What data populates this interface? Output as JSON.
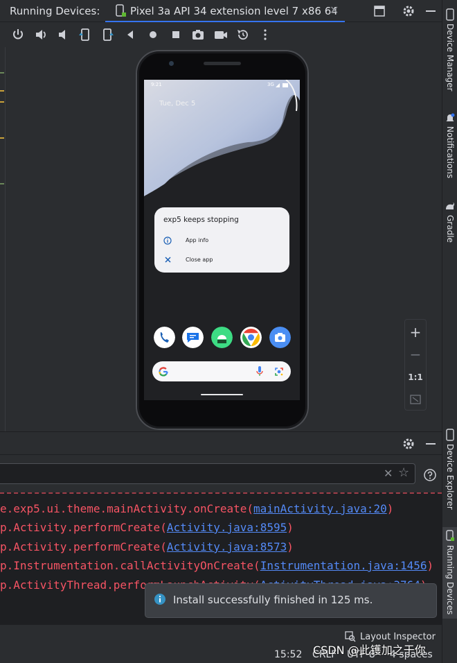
{
  "top_bar": {
    "title": "Running Devices:",
    "device_tab": "Pixel 3a API 34 extension level 7 x86 64",
    "close_glyph": "✕"
  },
  "device_toolbar": {
    "icons": [
      "power-icon",
      "volume-up-icon",
      "volume-down-icon",
      "rotate-left-icon",
      "rotate-right-icon",
      "back-icon",
      "home-icon",
      "overview-icon",
      "screenshot-icon",
      "screen-record-icon",
      "snapshot-icon",
      "more-icon"
    ]
  },
  "phone": {
    "status_time": "9:21",
    "status_network": "3G",
    "date": "Tue, Dec 5",
    "dialog": {
      "title": "exp5 keeps stopping",
      "app_info": "App info",
      "close_app": "Close app"
    },
    "dock_apps": [
      "phone",
      "messages",
      "android",
      "chrome",
      "camera"
    ]
  },
  "zoom": {
    "plus": "+",
    "minus": "−",
    "one_to_one": "1:1"
  },
  "right_bar": {
    "device_manager": "Device Manager",
    "notifications": "Notifications",
    "gradle": "Gradle",
    "device_explorer": "Device Explorer",
    "running_devices": "Running Devices"
  },
  "log": {
    "lines": [
      {
        "text": "e.exp5.ui.theme.mainActivity.onCreate(",
        "link": "mainActivity.java:20",
        "end": ")"
      },
      {
        "text": "p.Activity.performCreate(",
        "link": "Activity.java:8595",
        "end": ")"
      },
      {
        "text": "p.Activity.performCreate(",
        "link": "Activity.java:8573",
        "end": ")"
      },
      {
        "text": "p.Instrumentation.callActivityOnCreate(",
        "link": "Instrumentation.java:1456",
        "end": ")"
      },
      {
        "text": "p.ActivityThread.performLaunchActivity(",
        "link": "ActivityThread.java:3764",
        "end": ")"
      }
    ]
  },
  "toast": {
    "text": "Install successfully finished in 125 ms."
  },
  "status_bar": {
    "layout_inspector": "Layout Inspector",
    "time": "15:52",
    "line_separator": "CRLF",
    "encoding": "UTF-8",
    "indent": "4 spaces"
  },
  "watermark": "CSDN @此镬加之于你",
  "colors": {
    "accent": "#3574f0",
    "error": "#f75464",
    "link": "#548af7",
    "background": "#2b2d30"
  }
}
